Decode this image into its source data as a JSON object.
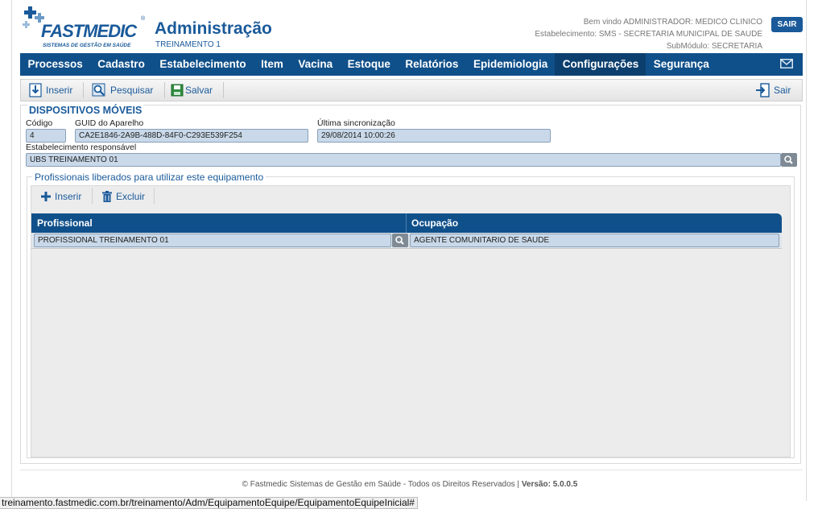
{
  "logo": {
    "brand": "FASTMEDIC",
    "subtitle": "SISTEMAS DE GESTÃO EM SAÚDE",
    "registered": "®"
  },
  "header": {
    "title": "Administração",
    "subtitle": "TREINAMENTO 1",
    "welcome": "Bem vindo ADMINISTRADOR: MEDICO CLINICO",
    "establishment": "Estabelecimento: SMS - SECRETARIA MUNICIPAL DE SAUDE",
    "submodule": "SubMódulo: SECRETARIA",
    "logout_label": "SAIR"
  },
  "nav": {
    "items": [
      "Processos",
      "Cadastro",
      "Estabelecimento",
      "Item",
      "Vacina",
      "Estoque",
      "Relatórios",
      "Epidemiologia",
      "Configurações",
      "Segurança"
    ],
    "active": "Configurações",
    "mail_icon": "mail-icon"
  },
  "toolbar": {
    "insert": "Inserir",
    "search": "Pesquisar",
    "save": "Salvar",
    "exit": "Sair"
  },
  "form": {
    "title": "DISPOSITIVOS MÓVEIS",
    "code_label": "Código",
    "code_value": "4",
    "guid_label": "GUID do Aparelho",
    "guid_value": "CA2E1846-2A9B-488D-84F0-C293E539F254",
    "sync_label": "Última sincronização",
    "sync_value": "29/08/2014 10:00:26",
    "estab_label": "Estabelecimento responsável",
    "estab_value": "UBS TREINAMENTO 01"
  },
  "professionals": {
    "title": "Profissionais liberados para utilizar este equipamento",
    "insert": "Inserir",
    "delete": "Excluir",
    "columns": [
      "Profissional",
      "Ocupação"
    ],
    "rows": [
      {
        "professional": "PROFISSIONAL TREINAMENTO 01",
        "occupation": "AGENTE COMUNITARIO DE SAUDE"
      }
    ]
  },
  "footer": {
    "copyright": "© Fastmedic Sistemas de Gestão em Saúde - Todos os Direitos Reservados |",
    "version_label": "Versão:",
    "version": "5.0.0.5"
  },
  "status_url": "treinamento.fastmedic.com.br/treinamento/Adm/EquipamentoEquipe/EquipamentoEquipeInicial#",
  "colors": {
    "brand": "#1a5a9a",
    "nav": "#10508a",
    "nav_active": "#0c3f6e",
    "field": "#c9d9e9"
  }
}
